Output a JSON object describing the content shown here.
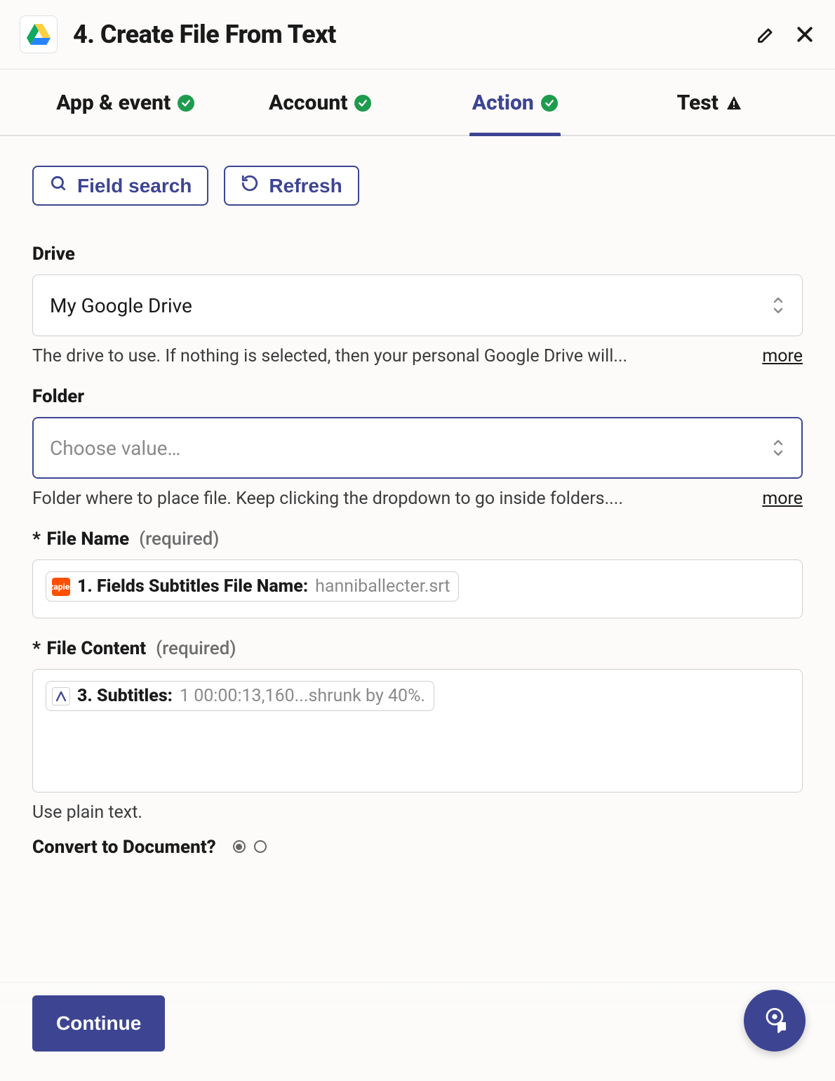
{
  "header": {
    "title": "4. Create File From Text"
  },
  "tabs": [
    {
      "label": "App & event",
      "status": "ok",
      "active": false
    },
    {
      "label": "Account",
      "status": "ok",
      "active": false
    },
    {
      "label": "Action",
      "status": "ok",
      "active": true
    },
    {
      "label": "Test",
      "status": "warn",
      "active": false
    }
  ],
  "toolbar": {
    "field_search_label": "Field search",
    "refresh_label": "Refresh"
  },
  "fields": {
    "drive": {
      "label": "Drive",
      "value": "My Google Drive",
      "help": "The drive to use. If nothing is selected, then your personal Google Drive will...",
      "more": "more"
    },
    "folder": {
      "label": "Folder",
      "placeholder": "Choose value…",
      "help": "Folder where to place file. Keep clicking the dropdown to go inside folders....",
      "more": "more"
    },
    "file_name": {
      "label": "File Name",
      "required_text": "(required)",
      "pill_label": "1. Fields Subtitles File Name:",
      "pill_value": "hanniballecter.srt",
      "pill_icon_text": "zapier",
      "pill_icon_bg": "#ff4f00"
    },
    "file_content": {
      "label": "File Content",
      "required_text": "(required)",
      "pill_label": "3. Subtitles:",
      "pill_value": "1 00:00:13,160...shrunk by 40%.",
      "pill_icon_bg": "#ffffff",
      "help": "Use plain text."
    },
    "convert": {
      "label": "Convert to Document?",
      "selected_index": 0
    }
  },
  "footer": {
    "continue_label": "Continue"
  }
}
